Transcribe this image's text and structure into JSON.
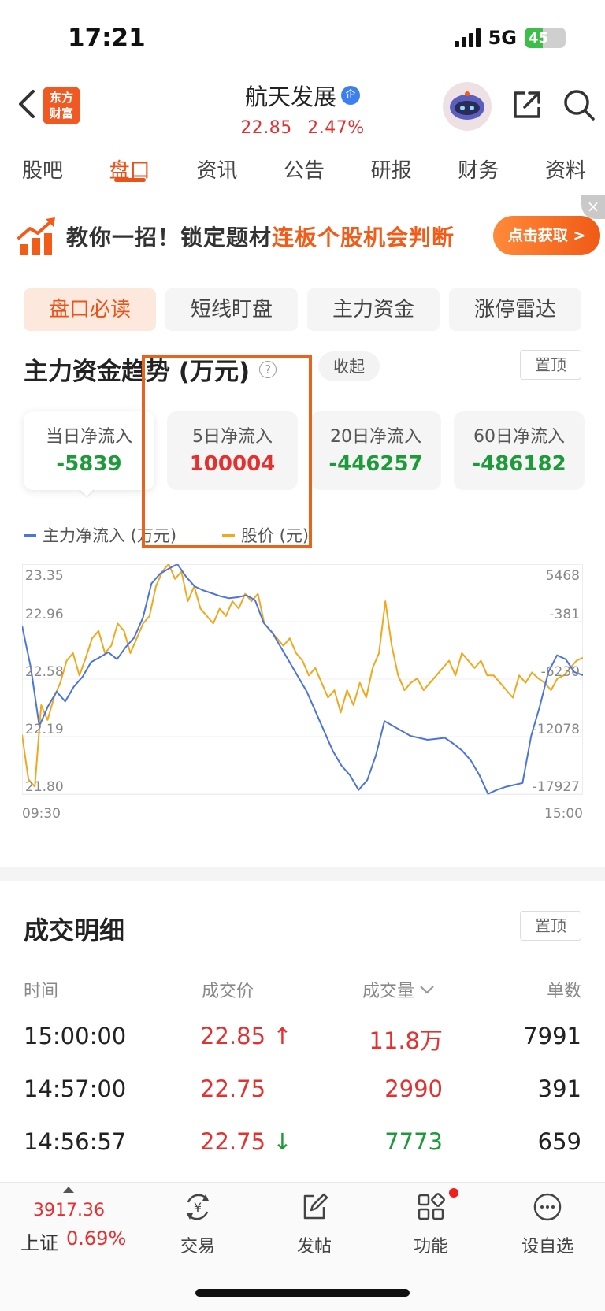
{
  "status": {
    "time": "17:21",
    "network": "5G",
    "battery": "45",
    "battery_level": 0.45
  },
  "header": {
    "logo_text": "东方财富",
    "stock_name": "航天发展",
    "stock_badge": "企",
    "price": "22.85",
    "change_pct": "2.47%"
  },
  "tabs": [
    {
      "label": "股吧",
      "active": false
    },
    {
      "label": "盘口",
      "active": true
    },
    {
      "label": "资讯",
      "active": false
    },
    {
      "label": "公告",
      "active": false
    },
    {
      "label": "研报",
      "active": false
    },
    {
      "label": "财务",
      "active": false
    },
    {
      "label": "资料",
      "active": false
    }
  ],
  "banner": {
    "text_main": "教你一招！锁定题材",
    "text_highlight": "连板个股机会判断",
    "button": "点击获取 >",
    "close": "×"
  },
  "segments": [
    {
      "label": "盘口必读",
      "active": true
    },
    {
      "label": "短线盯盘",
      "active": false
    },
    {
      "label": "主力资金",
      "active": false
    },
    {
      "label": "涨停雷达",
      "active": false
    }
  ],
  "fund_section": {
    "title": "主力资金趋势 (万元)",
    "help": "?",
    "collapse": "收起",
    "pin": "置顶",
    "cards": [
      {
        "label": "当日净流入",
        "value": "-5839",
        "color": "#1e9a3a",
        "selected": true
      },
      {
        "label": "5日净流入",
        "value": "100004",
        "color": "#e53030",
        "selected": false
      },
      {
        "label": "20日净流入",
        "value": "-446257",
        "color": "#1e9a3a",
        "selected": false
      },
      {
        "label": "60日净流入",
        "value": "-486182",
        "color": "#1e9a3a",
        "selected": false
      }
    ]
  },
  "chart_data": {
    "type": "line",
    "legend": [
      {
        "name": "主力净流入 (万元)",
        "color": "#4b74e0"
      },
      {
        "name": "股价 (元)",
        "color": "#f0a81e"
      }
    ],
    "y_left_ticks": [
      "23.35",
      "22.96",
      "22.58",
      "22.19",
      "21.80"
    ],
    "y_right_ticks": [
      "5468",
      "-381",
      "-6230",
      "-12078",
      "-17927"
    ],
    "x_ticks": [
      "09:30",
      "15:00"
    ],
    "y_left_range": [
      21.8,
      23.35
    ],
    "y_right_range": [
      -17927,
      5468
    ],
    "series": [
      {
        "name": "股价 (元)",
        "color": "#f0a81e",
        "axis": "left",
        "values": [
          22.2,
          21.9,
          21.85,
          22.4,
          22.3,
          22.45,
          22.55,
          22.7,
          22.75,
          22.6,
          22.72,
          22.85,
          22.9,
          22.75,
          22.8,
          22.95,
          22.9,
          22.75,
          22.85,
          22.95,
          23.0,
          23.2,
          23.3,
          23.35,
          23.25,
          23.3,
          23.1,
          23.2,
          23.05,
          23.0,
          22.95,
          23.05,
          23.0,
          23.1,
          23.05,
          23.15,
          23.1,
          23.15,
          22.95,
          22.9,
          22.85,
          22.8,
          22.85,
          22.75,
          22.7,
          22.6,
          22.65,
          22.55,
          22.45,
          22.5,
          22.35,
          22.5,
          22.4,
          22.55,
          22.45,
          22.65,
          22.75,
          23.1,
          22.8,
          22.6,
          22.5,
          22.55,
          22.58,
          22.5,
          22.55,
          22.6,
          22.65,
          22.7,
          22.6,
          22.75,
          22.7,
          22.65,
          22.7,
          22.6,
          22.6,
          22.55,
          22.5,
          22.45,
          22.6,
          22.55,
          22.62,
          22.58,
          22.55,
          22.5,
          22.58,
          22.6,
          22.65,
          22.7,
          22.72
        ]
      },
      {
        "name": "主力净流入 (万元)",
        "color": "#4b74e0",
        "axis": "right",
        "values": [
          -800,
          -5000,
          -11000,
          -9000,
          -7500,
          -8500,
          -7000,
          -6000,
          -4500,
          -4000,
          -3500,
          -4200,
          -3000,
          -2000,
          0,
          3500,
          4500,
          5000,
          5468,
          4200,
          3200,
          2800,
          2500,
          2200,
          2000,
          2100,
          2300,
          1800,
          -500,
          -1500,
          -3000,
          -4500,
          -6000,
          -7500,
          -9500,
          -11500,
          -13500,
          -15000,
          -16000,
          -17500,
          -16500,
          -14000,
          -10500,
          -11000,
          -11500,
          -12000,
          -12200,
          -12400,
          -12300,
          -12200,
          -12800,
          -13500,
          -14500,
          -16000,
          -17900,
          -17500,
          -17200,
          -17000,
          -16800,
          -12000,
          -9000,
          -5500,
          -3800,
          -4200,
          -5500,
          -5839
        ]
      }
    ]
  },
  "trades_section": {
    "title": "成交明细",
    "pin": "置顶",
    "headers": {
      "time": "时间",
      "price": "成交价",
      "volume": "成交量",
      "count": "单数"
    },
    "rows": [
      {
        "time": "15:00:00",
        "price": "22.85",
        "arrow": "↑",
        "volume": "11.8万",
        "count": "7991",
        "price_color": "#e53030",
        "vol_color": "#e53030"
      },
      {
        "time": "14:57:00",
        "price": "22.75",
        "arrow": "",
        "volume": "2990",
        "count": "391",
        "price_color": "#e53030",
        "vol_color": "#e53030"
      },
      {
        "time": "14:56:57",
        "price": "22.75",
        "arrow": "↓",
        "volume": "7773",
        "count": "659",
        "price_color": "#e53030",
        "vol_color": "#1e9a3a"
      }
    ]
  },
  "bottom_bar": {
    "index_value": "3917.36",
    "index_name": "上证",
    "index_change": "0.69%",
    "items": [
      {
        "label": "交易",
        "icon": "trade-icon"
      },
      {
        "label": "发帖",
        "icon": "post-icon"
      },
      {
        "label": "功能",
        "icon": "function-icon"
      },
      {
        "label": "设自选",
        "icon": "more-icon"
      }
    ]
  },
  "colors": {
    "accent": "#e9531a",
    "up": "#e53030",
    "down": "#1e9a3a"
  }
}
